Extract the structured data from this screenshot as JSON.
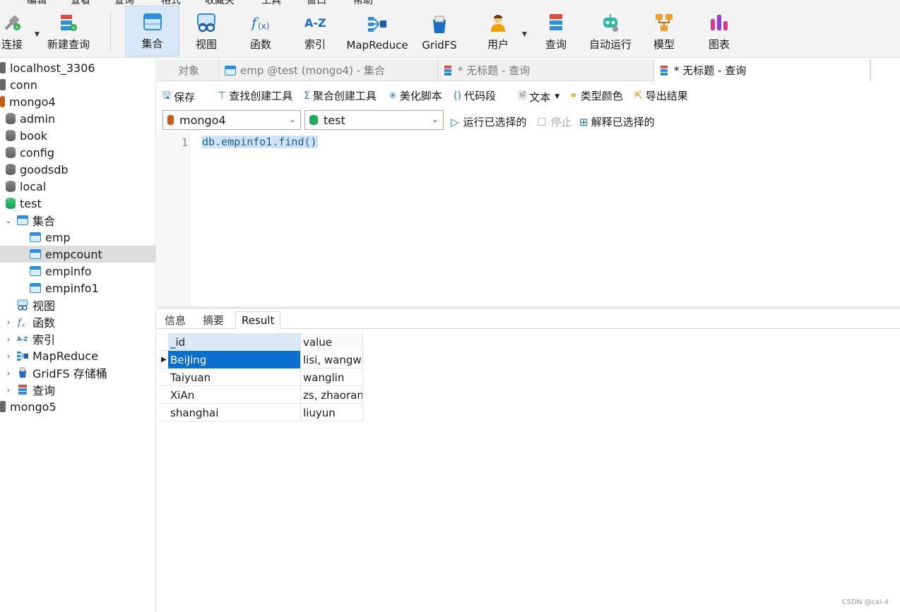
{
  "menu": [
    "编辑",
    "查看",
    "查询",
    "格式",
    "收藏夹",
    "工具",
    "窗口",
    "帮助"
  ],
  "toolbar": {
    "buttons": [
      {
        "label": "连接",
        "icon": "plug-icon"
      },
      {
        "label": "新建查询",
        "icon": "new-query-icon"
      },
      {
        "label": "集合",
        "icon": "collection-icon"
      },
      {
        "label": "视图",
        "icon": "view-icon"
      },
      {
        "label": "函数",
        "icon": "function-icon"
      },
      {
        "label": "索引",
        "icon": "index-icon"
      },
      {
        "label": "MapReduce",
        "icon": "mapreduce-icon"
      },
      {
        "label": "GridFS",
        "icon": "gridfs-icon"
      },
      {
        "label": "用户",
        "icon": "user-icon"
      },
      {
        "label": "查询",
        "icon": "query-icon"
      },
      {
        "label": "自动运行",
        "icon": "robot-icon"
      },
      {
        "label": "模型",
        "icon": "model-icon"
      },
      {
        "label": "图表",
        "icon": "chart-icon"
      }
    ]
  },
  "sidebar": {
    "items": [
      {
        "label": "localhost_3306"
      },
      {
        "label": "conn"
      },
      {
        "label": "mongo4"
      },
      {
        "label": "admin"
      },
      {
        "label": "book"
      },
      {
        "label": "config"
      },
      {
        "label": "goodsdb"
      },
      {
        "label": "local"
      },
      {
        "label": "test"
      },
      {
        "label": "集合"
      },
      {
        "label": "emp"
      },
      {
        "label": "empcount"
      },
      {
        "label": "empinfo"
      },
      {
        "label": "empinfo1"
      },
      {
        "label": "视图"
      },
      {
        "label": "函数"
      },
      {
        "label": "索引"
      },
      {
        "label": "MapReduce"
      },
      {
        "label": "GridFS 存储桶"
      },
      {
        "label": "查询"
      },
      {
        "label": "mongo5"
      }
    ]
  },
  "tabs": [
    {
      "label": "对象"
    },
    {
      "label": "emp @test (mongo4) - 集合"
    },
    {
      "label": "* 无标题 - 查询"
    },
    {
      "label": "* 无标题 - 查询"
    }
  ],
  "actions": [
    "保存",
    "查找创建工具",
    "聚合创建工具",
    "美化脚本",
    "代码段",
    "文本",
    "类型颜色",
    "导出结果"
  ],
  "connection": {
    "server": "mongo4",
    "database": "test"
  },
  "run": {
    "run_selected": "运行已选择的",
    "stop": "停止",
    "explain_selected": "解释已选择的"
  },
  "editor": {
    "line_number": "1",
    "code": "db.empinfo1.find()"
  },
  "result_tabs": [
    "信息",
    "摘要",
    "Result"
  ],
  "result": {
    "columns": [
      "_id",
      "value"
    ],
    "rows": [
      [
        "BeiJing",
        "lisi, wangwu"
      ],
      [
        "Taiyuan",
        "wanglin"
      ],
      [
        "XiAn",
        "zs, zhaoran"
      ],
      [
        "shanghai",
        "liuyun"
      ]
    ]
  },
  "watermark": "CSDN @cai-4",
  "colors": {
    "accent": "#0a6fcf",
    "active_toolbar": "#d7e8f8",
    "selected_row": "#dddddd"
  }
}
